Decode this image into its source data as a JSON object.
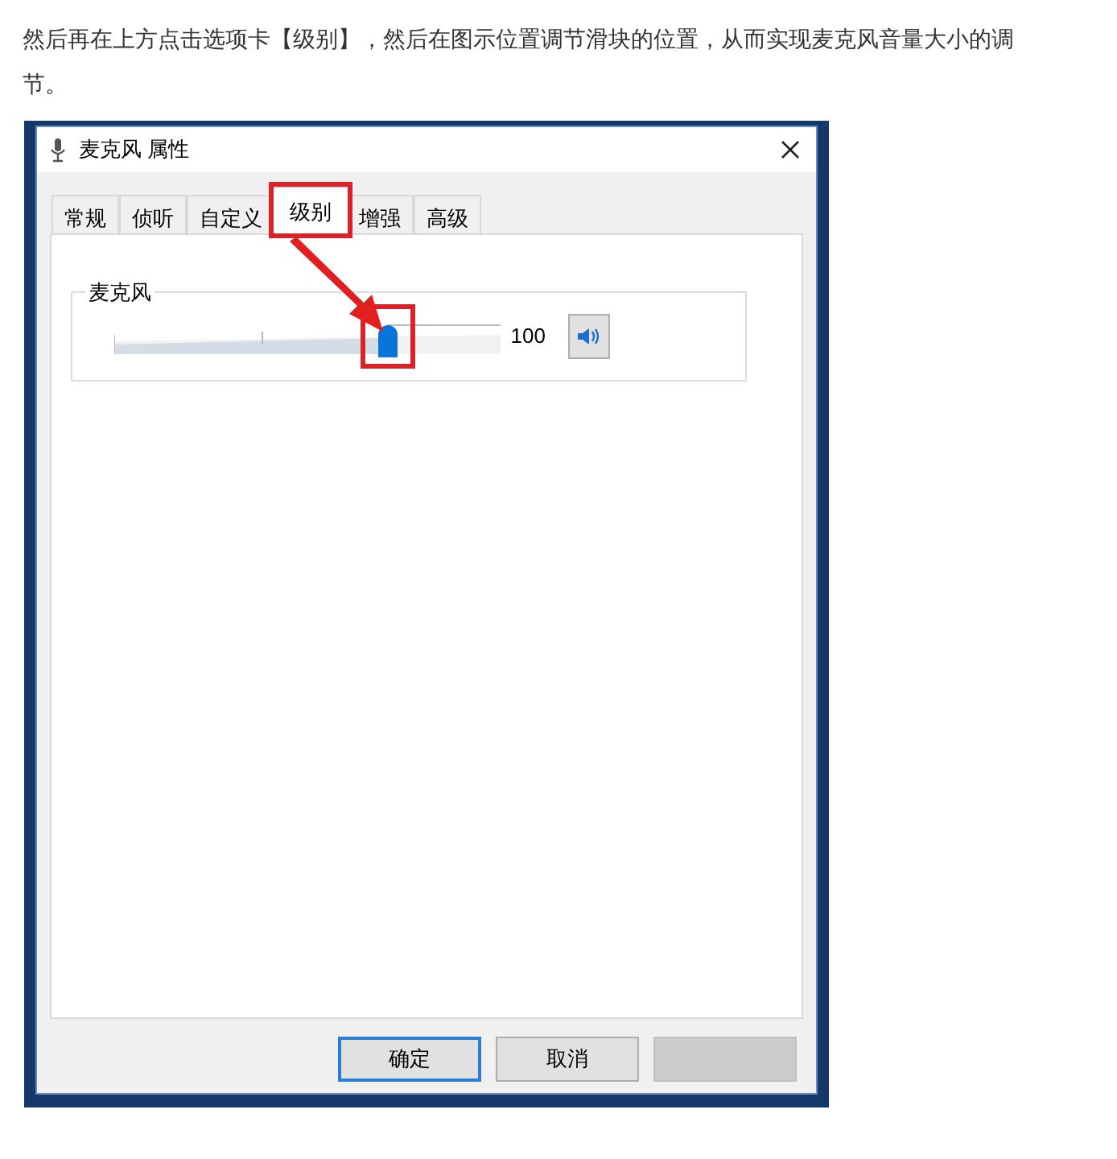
{
  "article": {
    "paragraph": "然后再在上方点击选项卡【级别】，然后在图示位置调节滑块的位置，从而实现麦克风音量大小的调节。"
  },
  "dialog": {
    "title": "麦克风 属性",
    "tabs": [
      {
        "label": "常规",
        "selected": false
      },
      {
        "label": "侦听",
        "selected": false
      },
      {
        "label": "自定义",
        "selected": false
      },
      {
        "label": "级别",
        "selected": true
      },
      {
        "label": "增强",
        "selected": false
      },
      {
        "label": "高级",
        "selected": false
      }
    ],
    "levels": [
      {
        "name": "麦克风",
        "level": 0.71,
        "reading": "100",
        "muted": false
      }
    ],
    "buttons": [
      {
        "label": "确定",
        "disabled": false,
        "default": true
      },
      {
        "label": "取消",
        "disabled": false,
        "default": false
      },
      {
        "disabled": true,
        "default": false
      }
    ]
  }
}
